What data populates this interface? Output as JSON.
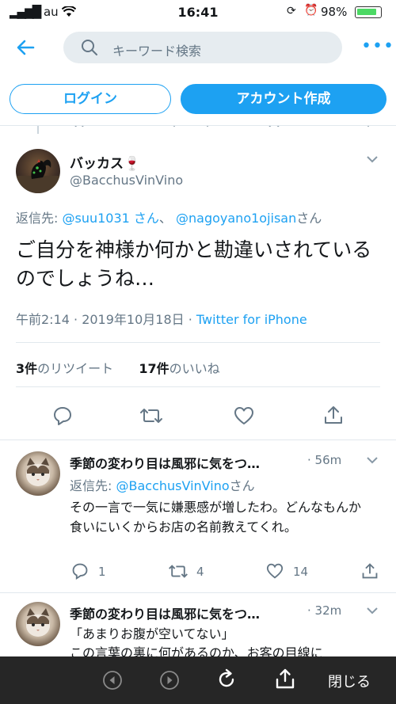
{
  "status_bar": {
    "carrier": "au",
    "time": "16:41",
    "battery": "98%"
  },
  "header": {
    "search_placeholder": "キーワード検索",
    "login_label": "ログイン",
    "signup_label": "アカウント作成"
  },
  "tweet": {
    "display_name": "バッカス🍷",
    "handle": "@BacchusVinVino",
    "reply_prefix": "返信先: ",
    "reply_user1": "@suu1031 さん",
    "reply_sep": "、 ",
    "reply_user2": "@nagoyano1ojisan",
    "reply_suffix": "さん",
    "text": "ご自分を神様か何かと勘違いされているのでしょうね…",
    "timestamp": "午前2:14 · 2019年10月18日 · ",
    "source": "Twitter for iPhone",
    "retweet_count": "3件",
    "retweet_label": "のリツイート",
    "like_count": "17件",
    "like_label": "のいいね"
  },
  "replies": [
    {
      "display_name": "季節の変わり目は風邪に気をつ…",
      "time": " · 56m",
      "reply_prefix": "返信先: ",
      "reply_user": "@BacchusVinVino",
      "reply_suffix": "さん",
      "text": "その一言で一気に嫌悪感が増したわ。どんなもんか食いにいくからお店の名前教えてくれ。",
      "replies": "1",
      "retweets": "4",
      "likes": "14"
    },
    {
      "display_name": "季節の変わり目は風邪に気をつ…",
      "time": " · 32m",
      "text_line1": "「あまりお腹が空いてない」",
      "text_line2": "この言葉の裏に何があるのか、お客の目線に"
    }
  ],
  "toolbar": {
    "close_label": "閉じる"
  },
  "colors": {
    "accent": "#1da1f2",
    "muted": "#657786",
    "toolbar": "#262626"
  }
}
